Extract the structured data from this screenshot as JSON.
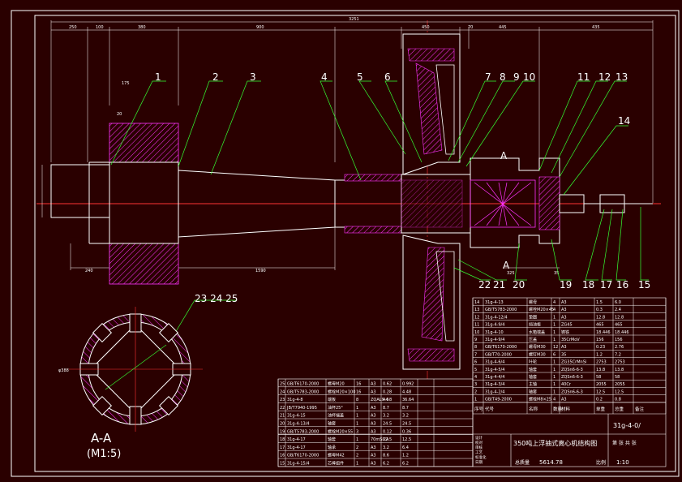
{
  "drawing": {
    "title": "350吨上浮抽式离心机结构图",
    "drawing_no": "31g-4-0/",
    "section_label": "A-A",
    "section_scale": "(M1:5)",
    "cut_marker": "A",
    "weight": "5614.78",
    "scale": "1:10"
  },
  "leaders": {
    "l1": "1",
    "l2": "2",
    "l3": "3",
    "l4": "4",
    "l5": "5",
    "l6": "6",
    "l7": "7",
    "l8": "8",
    "l9": "9",
    "l10": "10",
    "l11": "11",
    "l12": "12",
    "l13": "13",
    "l14": "14",
    "l15": "15",
    "l16": "16",
    "l17": "17",
    "l18": "18",
    "l19": "19",
    "l20": "20",
    "l21": "21",
    "l22": "22",
    "l232425": "23 24 25"
  },
  "dimensions": {
    "total": "3251",
    "d250": "250",
    "d100": "100",
    "d380": "380",
    "d900": "900",
    "d450": "450",
    "d70": "70",
    "d445": "445",
    "d435": "435",
    "d240": "240",
    "d1590": "1590",
    "d175": "175",
    "d20": "20",
    "d325": "325",
    "d35": "35",
    "d16": "16",
    "phi_ring": "φ388"
  },
  "bom_right": {
    "rows": [
      [
        "14",
        "31g-4-13",
        "螺母",
        "4",
        "A3",
        "1.5",
        "6.0"
      ],
      [
        "13",
        "GB/T5783-2000",
        "螺栓M20×45",
        "4",
        "A3",
        "0.3",
        "2.4"
      ],
      [
        "12",
        "31g-4-12/4",
        "垫圈",
        "1",
        "A3",
        "12.8",
        "12.8"
      ],
      [
        "11",
        "31g-4-9/4",
        "挡油板",
        "1",
        "ZG45",
        "465",
        "465"
      ],
      [
        "10",
        "31g-4-10",
        "水箱端盖",
        "1",
        "铸铁",
        "18.446",
        "18.446"
      ],
      [
        "9",
        "31g-4-9/4",
        "压盖",
        "1",
        "35CrMoV",
        "156",
        "156"
      ],
      [
        "8",
        "GB/T6170-2000",
        "螺母M30",
        "12",
        "A3",
        "0.23",
        "2.76"
      ],
      [
        "7",
        "GB/T70-2000",
        "螺钉M30",
        "6",
        "35",
        "1.2",
        "7.2"
      ],
      [
        "6",
        "31g-4-6/4",
        "叶轮",
        "1",
        "ZG35CrMnSi",
        "2753",
        "2753"
      ],
      [
        "5",
        "31g-4-5/4",
        "轴套",
        "1",
        "ZQSn6-6-3",
        "13.8",
        "13.8"
      ],
      [
        "4",
        "31g-4-4/4",
        "轴套",
        "1",
        "ZQSn6-6-3",
        "58",
        "58"
      ],
      [
        "3",
        "31g-4-3/4",
        "主轴",
        "1",
        "40Cr",
        "2055",
        "2055"
      ],
      [
        "2",
        "31g-4-2/4",
        "轴套",
        "1",
        "ZQSn6-6-3",
        "12.5",
        "12.5"
      ],
      [
        "1",
        "GB/T49-2000",
        "螺栓M8×25",
        "4",
        "A3",
        "0.2",
        "0.8"
      ]
    ],
    "header": [
      "序号",
      "代号",
      "名称",
      "数量",
      "材料",
      "单重",
      "总重",
      "备注"
    ]
  },
  "bom_left": {
    "rows": [
      [
        "25",
        "GB/T6170-2000",
        "螺母M20",
        "16",
        "A3",
        "0.62",
        "0.992"
      ],
      [
        "24",
        "GB/T5783-2000",
        "螺栓M20×100",
        "16",
        "A3",
        "0.28",
        "4.48"
      ],
      [
        "23",
        "31g-4-8",
        "端板",
        "8",
        "ZQAL9-4",
        "4.58",
        "36.64"
      ],
      [
        "22",
        "JB/T7940-1995",
        "油杯25°",
        "1",
        "A3",
        "8.7",
        "8.7"
      ],
      [
        "21",
        "31g-4-15",
        "油杯端盖",
        "1",
        "A3",
        "3.2",
        "3.2"
      ],
      [
        "20",
        "31g-4-13/4",
        "轴套",
        "1",
        "A3",
        "24.5",
        "24.5"
      ],
      [
        "19",
        "GB/T5783-2000",
        "螺栓M20×55",
        "3",
        "A3",
        "0.12",
        "0.36"
      ],
      [
        "18",
        "31g-4-17",
        "轴套",
        "1",
        "70mSi2A",
        "12.5",
        "12.5"
      ],
      [
        "17",
        "31g-4-17",
        "轴承",
        "2",
        "A3",
        "3.2",
        "6.4"
      ],
      [
        "16",
        "GB/T6170-2000",
        "螺母M42",
        "2",
        "A3",
        "8.6",
        "1.2"
      ],
      [
        "15",
        "31g-4-15/4",
        "芯棒组件",
        "1",
        "A3",
        "6.2",
        "6.2"
      ]
    ]
  },
  "title_block": {
    "labels": [
      "设计",
      "校对",
      "审核",
      "工艺",
      "标准化",
      "日期"
    ],
    "weight_label": "总质量",
    "scale_label": "比例",
    "sheet_label": "第 张 共 张"
  }
}
